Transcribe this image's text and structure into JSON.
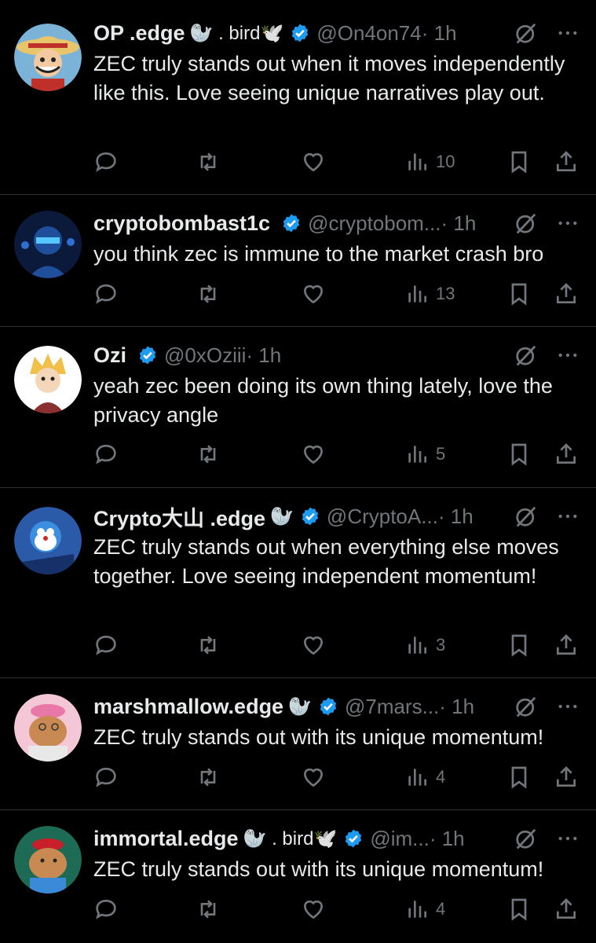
{
  "icons": {
    "verified": "verified-badge-icon",
    "grok": "grok-icon",
    "more": "more-icon",
    "reply": "reply-icon",
    "repost": "repost-icon",
    "like": "like-icon",
    "views": "views-icon",
    "bookmark": "bookmark-icon",
    "share": "share-icon"
  },
  "colors": {
    "background": "#000000",
    "text": "#e7e9ea",
    "muted": "#71767b",
    "verified": "#1d9bf0",
    "divider": "#2f3336"
  },
  "tweets": [
    {
      "name": "OP .edge",
      "emoji": "🦭 . bird🕊️",
      "handle": "@On4on74",
      "time": "· 1h",
      "text": "ZEC truly stands out when it moves independently like this. Love seeing unique narratives play out.",
      "views": "10"
    },
    {
      "name": "cryptobombast1c",
      "emoji": "",
      "handle": "@cryptobom...",
      "time": "· 1h",
      "text": "you think zec is immune to the market crash bro",
      "views": "13"
    },
    {
      "name": "Ozi",
      "emoji": "",
      "handle": "@0xOziii",
      "time": "· 1h",
      "text": "yeah zec been doing its own thing lately, love the privacy angle",
      "views": "5"
    },
    {
      "name": "Crypto大山 .edge",
      "emoji": "🦭",
      "handle": "@CryptoA...",
      "time": "· 1h",
      "text": "ZEC truly stands out when everything else moves together. Love seeing independent momentum!",
      "views": "3"
    },
    {
      "name": "marshmallow.edge",
      "emoji": "🦭",
      "handle": "@7mars...",
      "time": "· 1h",
      "text": "ZEC truly stands out with its unique momentum!",
      "views": "4"
    },
    {
      "name": "immortal.edge",
      "emoji": "🦭 . bird🕊️",
      "handle": "@im...",
      "time": "· 1h",
      "text": "ZEC truly stands out with its unique momentum!",
      "views": "4"
    }
  ]
}
